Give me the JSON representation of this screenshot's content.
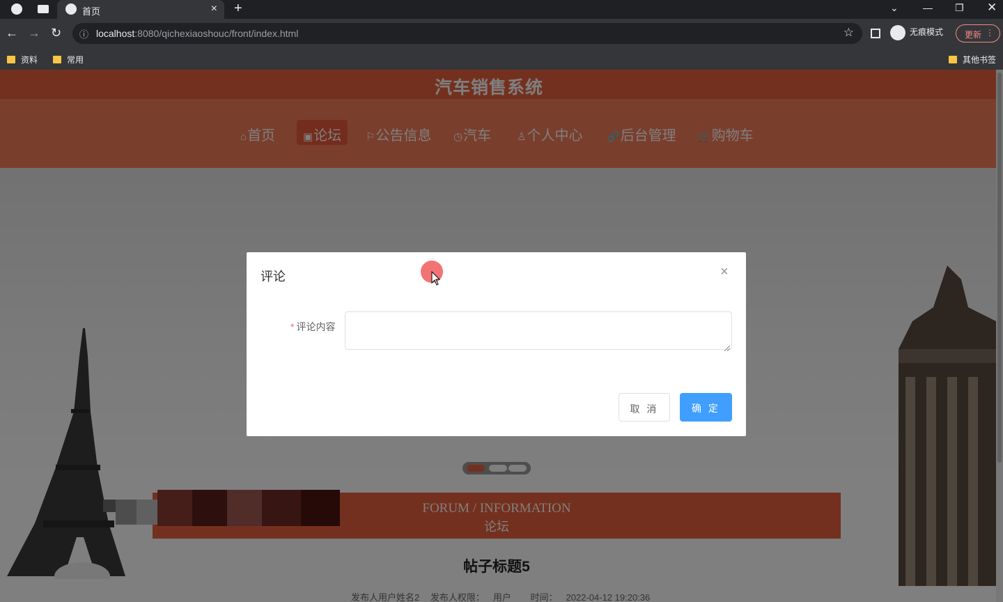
{
  "browser": {
    "tab_title": "首页",
    "url_host": "localhost",
    "url_rest": ":8080/qichexiaoshouc/front/index.html",
    "incognito_label": "无痕模式",
    "update_label": "更新",
    "bookmarks": [
      "资料",
      "常用"
    ],
    "other_bookmarks": "其他书签"
  },
  "site": {
    "title": "汽车销售系统",
    "nav": [
      {
        "icon": "⌂",
        "label": "首页"
      },
      {
        "icon": "▣",
        "label": "论坛"
      },
      {
        "icon": "⚐",
        "label": "公告信息"
      },
      {
        "icon": "◷",
        "label": "汽车"
      },
      {
        "icon": "♙",
        "label": "个人中心"
      },
      {
        "icon": "🔗",
        "label": "后台管理"
      },
      {
        "icon": "🛒",
        "label": "购物车"
      }
    ],
    "active_nav": "论坛",
    "accent_color": "#e8603c"
  },
  "section": {
    "en": "FORUM / INFORMATION",
    "zh": "论坛"
  },
  "post": {
    "title": "帖子标题5",
    "publisher_label": "发布人用户姓名2",
    "role_label": "发布人权限：",
    "role_value": "用户",
    "time_label": "时间：",
    "time_value": "2022-04-12 19:20:36"
  },
  "dialog": {
    "title": "评论",
    "field_required_mark": "*",
    "field_label": "评论内容",
    "field_value": "",
    "cancel_label": "取 消",
    "confirm_label": "确 定",
    "primary_color": "#409eff"
  }
}
